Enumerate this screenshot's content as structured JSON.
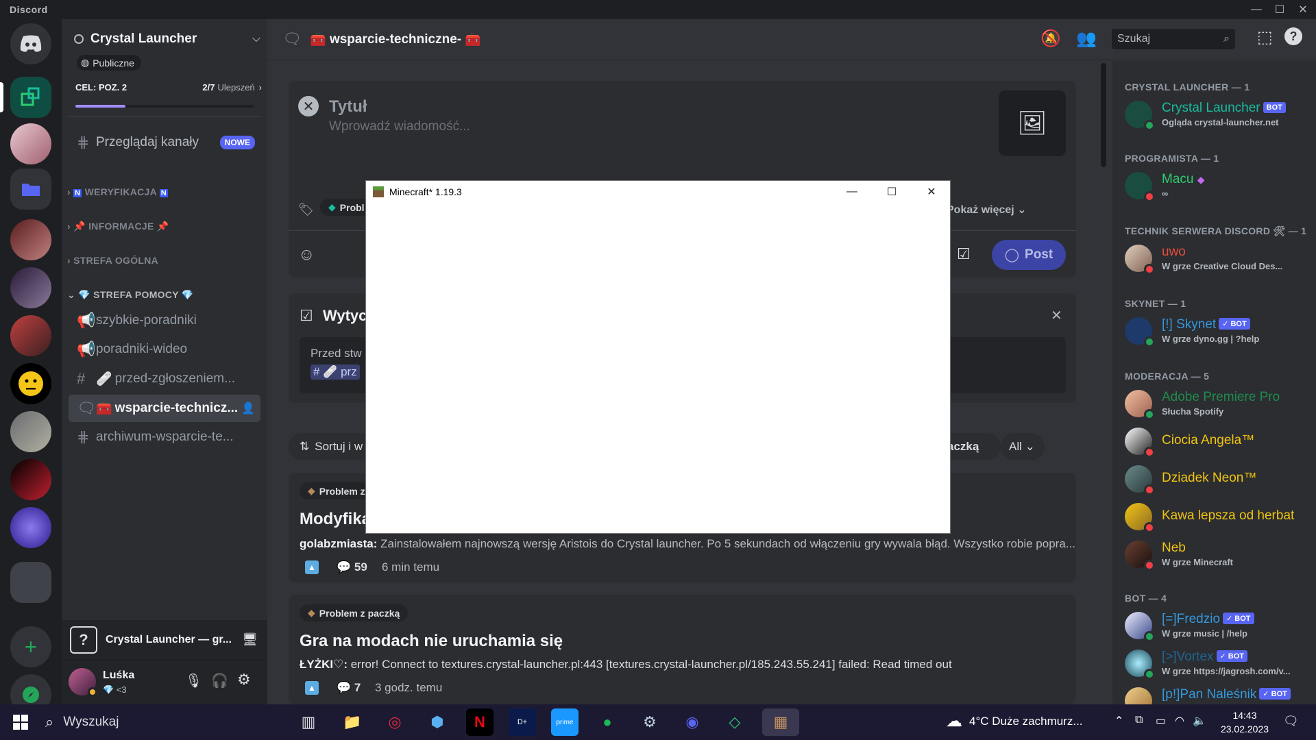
{
  "app": {
    "brand": "Discord"
  },
  "server": {
    "name": "Crystal Launcher",
    "badge": "Publiczne",
    "goal_label": "CEL: POZ. 2",
    "boosts": "2/7",
    "boost_label": "Ulepszeń",
    "browse_channels": "Przeglądaj kanały",
    "new_badge": "NOWE"
  },
  "sections": [
    {
      "label": "WERYFIKACJA"
    },
    {
      "label": "INFORMACJE"
    },
    {
      "label": "STREFA OGÓLNA"
    },
    {
      "label": "STREFA POMOCY"
    }
  ],
  "channels": [
    {
      "label": "szybkie-poradniki"
    },
    {
      "label": "poradniki-wideo"
    },
    {
      "label": "przed-zgłoszeniem..."
    },
    {
      "label": "wsparcie-technicz..."
    },
    {
      "label": "archiwum-wsparcie-te..."
    }
  ],
  "voice": {
    "label": "Crystal Launcher — gr..."
  },
  "user": {
    "name": "Luśka",
    "status": "<3"
  },
  "header": {
    "channel": "wsparcie-techniczne-",
    "search_placeholder": "Szukaj"
  },
  "composer": {
    "title_placeholder": "Tytuł",
    "message_placeholder": "Wprowadź wiadomość...",
    "tag_partial": "Probl",
    "show_more": "Pokaż więcej",
    "post_label": "Post"
  },
  "guidelines": {
    "title": "Wytyc",
    "text": "Przed stw",
    "link": "prz"
  },
  "sort": {
    "label": "Sortuj i w",
    "filter_tag": "aczką",
    "all": "All"
  },
  "posts": [
    {
      "tag": "Problem z",
      "title": "Modyfika",
      "author": "golabzmiasta:",
      "excerpt": "Zainstalowałem najnowszą wersję Aristois do Crystal launcher. Po 5 sekundach od włączeniu gry wywala błąd. Wszystko robie popra...",
      "replies": "59",
      "time": "6 min temu"
    },
    {
      "tag": "Problem z paczką",
      "title": "Gra na modach nie uruchamia się",
      "author": "ŁYŻKI♡:",
      "excerpt": "error! Connect to textures.crystal-launcher.pl:443 [textures.crystal-launcher.pl/185.243.55.241] failed: Read timed out",
      "replies": "7",
      "time": "3 godz. temu"
    }
  ],
  "member_groups": [
    {
      "label": "CRYSTAL LAUNCHER — 1"
    },
    {
      "label": "PROGRAMISTA — 1"
    },
    {
      "label": "TECHNIK SERWERA DISCORD 🛠 — 1"
    },
    {
      "label": "SKYNET — 1"
    },
    {
      "label": "MODERACJA — 5"
    },
    {
      "label": "BOT — 4"
    }
  ],
  "members": [
    {
      "name": "Crystal Launcher",
      "activity": "Ogląda crystal-launcher.net",
      "color": "#1abc9c",
      "bot": "BOT"
    },
    {
      "name": "Macu",
      "activity": "",
      "color": "#2ecc71"
    },
    {
      "name": "uwo",
      "activity": "W grze Creative Cloud Des...",
      "color": "#e74c3c"
    },
    {
      "name": "[!] Skynet",
      "activity": "W grze dyno.gg | ?help",
      "color": "#3498db",
      "bot": "✓ BOT"
    },
    {
      "name": "Adobe Premiere Pro",
      "activity": "Słucha Spotify",
      "color": "#1f8b4c"
    },
    {
      "name": "Ciocia Angela™",
      "activity": "",
      "color": "#f1c40f"
    },
    {
      "name": "Dziadek Neon™",
      "activity": "",
      "color": "#f1c40f"
    },
    {
      "name": "Kawa lepsza od herbat",
      "activity": "",
      "color": "#f1c40f"
    },
    {
      "name": "Neb",
      "activity": "W grze Minecraft",
      "color": "#f1c40f"
    },
    {
      "name": "[=]Fredzio",
      "activity": "W grze music | /help",
      "color": "#3498db",
      "bot": "✓ BOT"
    },
    {
      "name": "[>]Vortex",
      "activity": "W grze https://jagrosh.com/v...",
      "color": "#206694",
      "bot": "✓ BOT"
    },
    {
      "name": "[p!]Pan Naleśnik",
      "activity": "",
      "color": "#3498db",
      "bot": "✓ BOT"
    }
  ],
  "minecraft": {
    "title": "Minecraft* 1.19.3"
  },
  "taskbar": {
    "search": "Wyszukaj",
    "weather": "4°C  Duże zachmurz...",
    "time": "14:43",
    "date": "23.02.2023"
  },
  "colors": {
    "accent": "#5865f2",
    "online": "#23a55a",
    "dnd": "#f23f43"
  }
}
